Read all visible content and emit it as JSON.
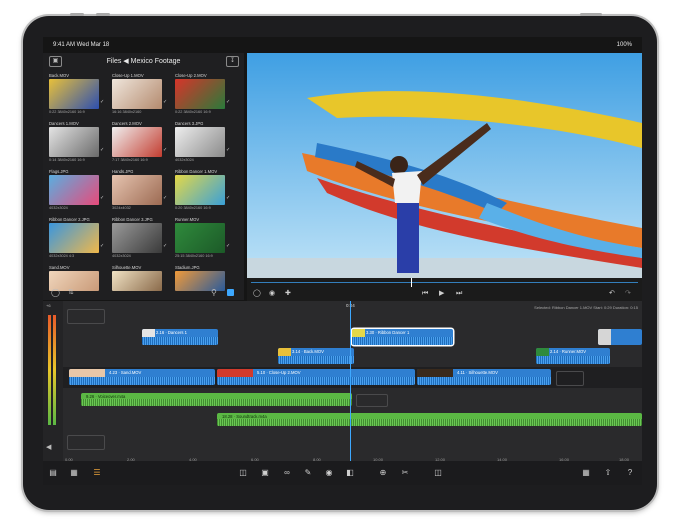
{
  "status": {
    "time": "9:41 AM  Wed Mar 18",
    "battery": "100%"
  },
  "browser": {
    "title": "Files ◀ Mexico Footage",
    "clips": [
      {
        "name": "Back.MOV",
        "meta": "0:22  3840x2160  16:9",
        "color": "#e8b93a"
      },
      {
        "name": "Close-Up 1.MOV",
        "meta": "16:16  3840x2160",
        "color": "#c7a48a"
      },
      {
        "name": "Close-Up 2.MOV",
        "meta": "0:22  3840x2160  16:9",
        "color": "#d23a2c"
      },
      {
        "name": "Dancers 1.MOV",
        "meta": "0:14  3840x2160  16:9",
        "color": "#dcdcdc"
      },
      {
        "name": "Dancers 2.MOV",
        "meta": "7:17  3840x2160  16:9",
        "color": "#c94a3b"
      },
      {
        "name": "Dancers 3.JPG",
        "meta": "4032x3024",
        "color": "#d8d8d8"
      },
      {
        "name": "Flags.JPG",
        "meta": "4032x3024",
        "color": "#4ea3d8"
      },
      {
        "name": "Hands.JPG",
        "meta": "3024x4032",
        "color": "#cfa38f"
      },
      {
        "name": "Ribbon Dancer 1.MOV",
        "meta": "0:20  3840x2160  16:9",
        "color": "#d6cf47"
      },
      {
        "name": "Ribbon Dancer 2.JPG",
        "meta": "4032x3024  4:3",
        "color": "#3a8fd6"
      },
      {
        "name": "Ribbon Dancer 3.JPG",
        "meta": "4032x3024",
        "color": "#7b7b7b"
      },
      {
        "name": "Runner.MOV",
        "meta": "25:15  3840x2160  16:9",
        "color": "#2f8a3c"
      },
      {
        "name": "Sand.MOV",
        "meta": "",
        "color": "#e8c7a8"
      },
      {
        "name": "Silhouette.MOV",
        "meta": "",
        "color": "#e8d8b8"
      },
      {
        "name": "Stadium.JPG",
        "meta": "",
        "color": "#e88a2a"
      }
    ]
  },
  "timeline": {
    "playhead": "0:04",
    "selection_info": "Selected: Ribbon Dancer 1.MOV  Start: 0:29  Duration: 0:15",
    "connected": [
      {
        "label": "2.16 · Dancers 1"
      },
      {
        "label": "3.30 · Ribbon Dancer 1"
      },
      {
        "label": "3.14 · Back.MOV"
      },
      {
        "label": "2.14 · Runner.MOV"
      }
    ],
    "main": [
      {
        "label": "4.23 · Sand.MOV"
      },
      {
        "label": "5.10 · Close-Up 2.MOV"
      },
      {
        "label": "4.11 · Silhouette.MOV"
      }
    ],
    "audio": [
      {
        "label": "9.26 · Voiceover.m4a"
      },
      {
        "label": "18.28 · Soundtrack.m4a"
      }
    ],
    "ticks": [
      "0.00",
      "2.00",
      "4.00",
      "6.00",
      "8.00",
      "10.00",
      "12.00",
      "14.00",
      "16.00",
      "18.00"
    ]
  },
  "accent": "#3da8ff",
  "icons": [
    "back-icon",
    "rewind-icon",
    "play-icon",
    "forward-icon",
    "undo-icon",
    "scissors-icon",
    "trash-icon",
    "share-icon",
    "help-icon"
  ]
}
